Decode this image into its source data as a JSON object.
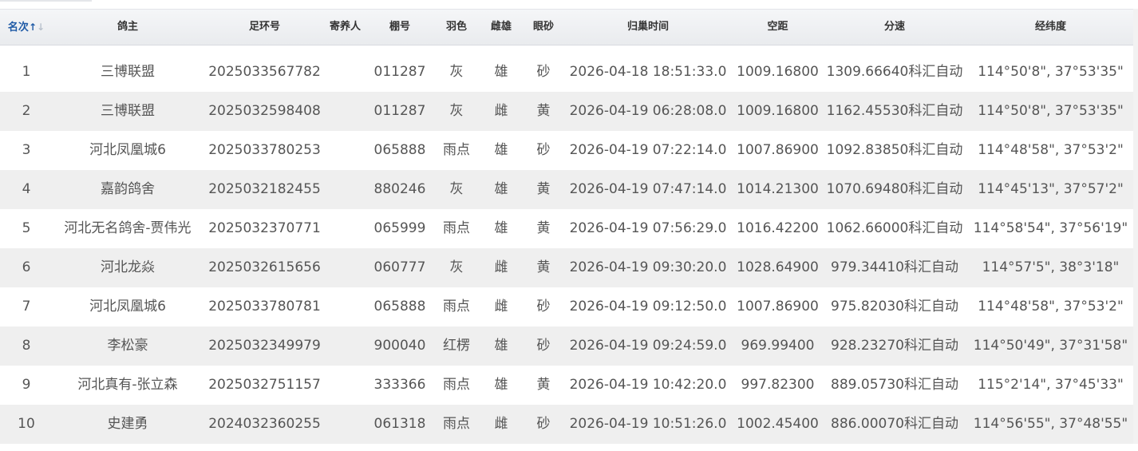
{
  "table": {
    "headers": [
      "名次",
      "鸽主",
      "足环号",
      "寄养人",
      "棚号",
      "羽色",
      "雌雄",
      "眼砂",
      "归巢时间",
      "空距",
      "分速",
      "经纬度"
    ],
    "sort_arrow_up": "↑",
    "sort_arrow_down": "↓",
    "rows": [
      [
        "1",
        "三博联盟",
        "2025033567782",
        "",
        "011287",
        "灰",
        "雄",
        "砂",
        "2026-04-18 18:51:33.0",
        "1009.16800",
        "1309.66640科汇自动",
        "114°50'8\", 37°53'35\""
      ],
      [
        "2",
        "三博联盟",
        "2025032598408",
        "",
        "011287",
        "灰",
        "雌",
        "黄",
        "2026-04-19 06:28:08.0",
        "1009.16800",
        "1162.45530科汇自动",
        "114°50'8\", 37°53'35\""
      ],
      [
        "3",
        "河北凤凰城6",
        "2025033780253",
        "",
        "065888",
        "雨点",
        "雄",
        "砂",
        "2026-04-19 07:22:14.0",
        "1007.86900",
        "1092.83850科汇自动",
        "114°48'58\", 37°53'2\""
      ],
      [
        "4",
        "嘉韵鸽舍",
        "2025032182455",
        "",
        "880246",
        "灰",
        "雄",
        "黄",
        "2026-04-19 07:47:14.0",
        "1014.21300",
        "1070.69480科汇自动",
        "114°45'13\", 37°57'2\""
      ],
      [
        "5",
        "河北无名鸽舍-贾伟光",
        "2025032370771",
        "",
        "065999",
        "雨点",
        "雄",
        "黄",
        "2026-04-19 07:56:29.0",
        "1016.42200",
        "1062.66000科汇自动",
        "114°58'54\", 37°56'19\""
      ],
      [
        "6",
        "河北龙焱",
        "2025032615656",
        "",
        "060777",
        "灰",
        "雌",
        "黄",
        "2026-04-19 09:30:20.0",
        "1028.64900",
        "979.34410科汇自动",
        "114°57'5\", 38°3'18\""
      ],
      [
        "7",
        "河北凤凰城6",
        "2025033780781",
        "",
        "065888",
        "雨点",
        "雌",
        "砂",
        "2026-04-19 09:12:50.0",
        "1007.86900",
        "975.82030科汇自动",
        "114°48'58\", 37°53'2\""
      ],
      [
        "8",
        "李松豪",
        "2025032349979",
        "",
        "900040",
        "红楞",
        "雄",
        "砂",
        "2026-04-19 09:24:59.0",
        "969.99400",
        "928.23270科汇自动",
        "114°50'49\", 37°31'58\""
      ],
      [
        "9",
        "河北真有-张立森",
        "2025032751157",
        "",
        "333366",
        "雨点",
        "雄",
        "黄",
        "2026-04-19 10:42:20.0",
        "997.82300",
        "889.05730科汇自动",
        "115°2'14\", 37°45'33\""
      ],
      [
        "10",
        "史建勇",
        "2024032360255",
        "",
        "061318",
        "雨点",
        "雌",
        "砂",
        "2026-04-19 10:51:26.0",
        "1002.45400",
        "886.00070科汇自动",
        "114°56'55\", 37°48'55\""
      ]
    ]
  }
}
